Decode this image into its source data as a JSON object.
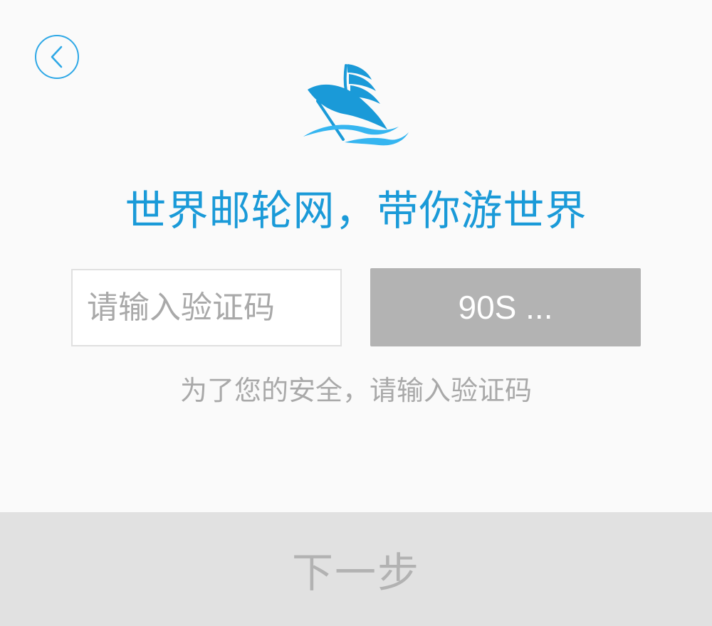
{
  "header": {
    "back_icon": "chevron-left-icon",
    "logo_icon": "cruise-ship-icon"
  },
  "slogan": "世界邮轮网，带你游世界",
  "verification": {
    "input_value": "",
    "input_placeholder": "请输入验证码",
    "countdown_label": "90S ...",
    "hint": "为了您的安全，请输入验证码"
  },
  "footer": {
    "next_label": "下一步"
  },
  "colors": {
    "accent": "#1a9ad8",
    "logo_light": "#35b5f0",
    "disabled_button": "#b3b3b3",
    "footer_bg": "#e1e1e1",
    "muted_text": "#a9a9a9"
  }
}
